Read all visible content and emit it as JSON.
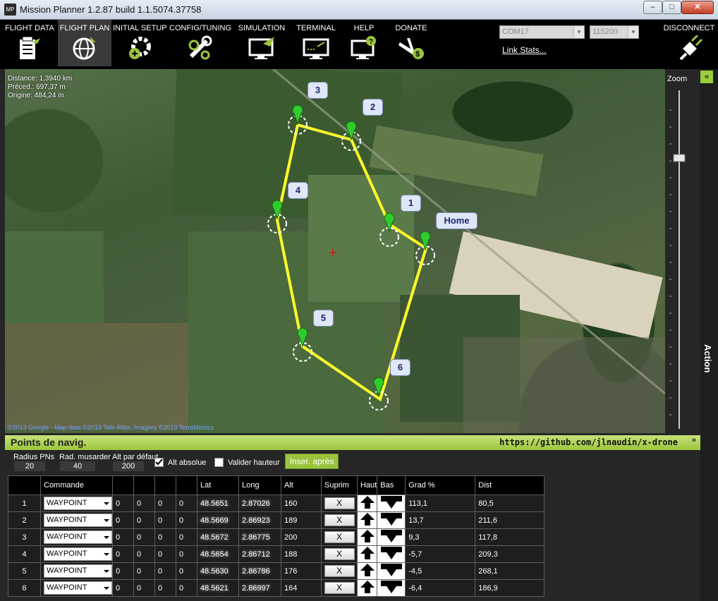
{
  "window": {
    "title": "Mission Planner 1.2.87 build 1.1.5074.37758",
    "app_icon_text": "MP"
  },
  "menu": [
    {
      "label": "FLIGHT DATA",
      "icon": "flight-data-icon"
    },
    {
      "label": "FLIGHT PLAN",
      "icon": "globe-icon",
      "active": true
    },
    {
      "label": "INITIAL SETUP",
      "icon": "setup-icon"
    },
    {
      "label": "CONFIG/TUNING",
      "icon": "wrench-icon"
    },
    {
      "label": "SIMULATION",
      "icon": "simulation-icon"
    },
    {
      "label": "TERMINAL",
      "icon": "terminal-icon"
    },
    {
      "label": "HELP",
      "icon": "help-icon"
    },
    {
      "label": "DONATE",
      "icon": "donate-icon"
    }
  ],
  "connection": {
    "port": "COM17",
    "baud": "115200",
    "link_stats": "Link Stats...",
    "disconnect": "DISCONNECT"
  },
  "map": {
    "distance": "Distance: 1,3940 km",
    "previous": "Préced.: 697,37 m",
    "origin": "Origine: 484,24 m",
    "copyright": "©2013 Google - Map data ©2013 Tele Atlas, Imagery ©2013 TerraMetrics",
    "zoom_label": "Zoom",
    "waypoint_labels": [
      "Home",
      "1",
      "2",
      "3",
      "4",
      "5",
      "6"
    ],
    "watermark": "©2013 Google"
  },
  "action_panel": {
    "label": "Action",
    "collapse": "«"
  },
  "waypoints_panel": {
    "title": "Points de navig.",
    "link": "https://github.com/jlnaudin/x-drone",
    "collapse": "»",
    "radius_label": "Radius PNs",
    "radius_value": "20",
    "loiter_label": "Rad. musarder",
    "loiter_value": "40",
    "alt_label": "Alt par défaut",
    "alt_value": "200",
    "abs_alt_label": "Alt absolue",
    "abs_alt_checked": true,
    "verify_height_label": "Valider hauteur",
    "verify_height_checked": false,
    "insert_button": "Inser. après"
  },
  "table": {
    "headers": [
      "",
      "Commande",
      "",
      "",
      "",
      "",
      "Lat",
      "Long",
      "Alt",
      "Suprim",
      "Haut",
      "Bas",
      "Grad %",
      "Dist"
    ],
    "delete_label": "X",
    "rows": [
      {
        "n": "1",
        "cmd": "WAYPOINT",
        "p1": "0",
        "p2": "0",
        "p3": "0",
        "p4": "0",
        "lat": "48.5651",
        "lng": "2.87026",
        "alt": "160",
        "grad": "113,1",
        "dist": "80,5"
      },
      {
        "n": "2",
        "cmd": "WAYPOINT",
        "p1": "0",
        "p2": "0",
        "p3": "0",
        "p4": "0",
        "lat": "48.5669",
        "lng": "2.86923",
        "alt": "189",
        "grad": "13,7",
        "dist": "211,6"
      },
      {
        "n": "3",
        "cmd": "WAYPOINT",
        "p1": "0",
        "p2": "0",
        "p3": "0",
        "p4": "0",
        "lat": "48.5672",
        "lng": "2.86775",
        "alt": "200",
        "grad": "9,3",
        "dist": "117,8"
      },
      {
        "n": "4",
        "cmd": "WAYPOINT",
        "p1": "0",
        "p2": "0",
        "p3": "0",
        "p4": "0",
        "lat": "48.5654",
        "lng": "2.86712",
        "alt": "188",
        "grad": "-5,7",
        "dist": "209,3"
      },
      {
        "n": "5",
        "cmd": "WAYPOINT",
        "p1": "0",
        "p2": "0",
        "p3": "0",
        "p4": "0",
        "lat": "48.5630",
        "lng": "2.86786",
        "alt": "176",
        "grad": "-4,5",
        "dist": "268,1"
      },
      {
        "n": "6",
        "cmd": "WAYPOINT",
        "p1": "0",
        "p2": "0",
        "p3": "0",
        "p4": "0",
        "lat": "48.5621",
        "lng": "2.86997",
        "alt": "164",
        "grad": "-6,4",
        "dist": "186,9"
      }
    ]
  },
  "colors": {
    "accent": "#9bc43c",
    "route": "#ffff2a",
    "marker": "#2ecc2e",
    "callout": "#dfe6f7"
  }
}
